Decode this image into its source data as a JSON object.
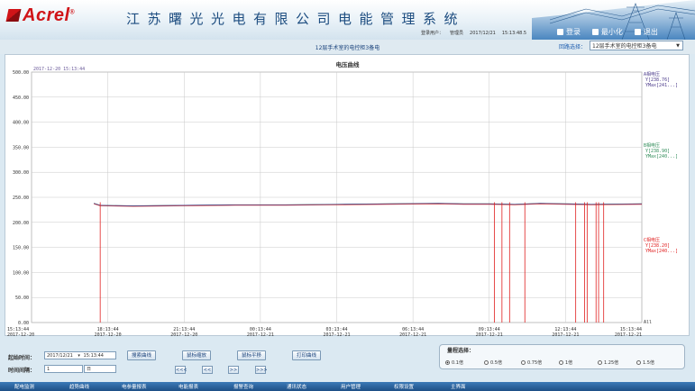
{
  "brand": {
    "logo_text": "Acrel",
    "company_name": "江苏曙光光电有限公司电能管理系统"
  },
  "login_info": {
    "user_label": "登录用户：",
    "user_name": "管理员",
    "date": "2017/12/21",
    "time": "15:13:48.5"
  },
  "top_buttons": [
    {
      "label": "登录",
      "icon": "login-icon"
    },
    {
      "label": "最小化",
      "icon": "minimize-icon"
    },
    {
      "label": "退出",
      "icon": "exit-icon"
    }
  ],
  "page": {
    "title": "12层手术室的电控柜3备电"
  },
  "loop": {
    "label": "回路选择：",
    "selected": "12层手术室的电控柜3备电"
  },
  "chart_data": {
    "type": "line",
    "title": "电压曲线",
    "timestamp_label": "2017-12-20 15:13:44",
    "y_ticks": [
      "500.00",
      "450.00",
      "400.00",
      "350.00",
      "300.00",
      "250.00",
      "200.00",
      "150.00",
      "100.00",
      "50.00",
      "0.00"
    ],
    "ylim": [
      0,
      500
    ],
    "x_ticks": [
      {
        "time": "15:13:44",
        "date": "2017-12-20"
      },
      {
        "time": "18:13:44",
        "date": "2017-12-20"
      },
      {
        "time": "21:13:44",
        "date": "2017-12-20"
      },
      {
        "time": "00:13:44",
        "date": "2017-12-21"
      },
      {
        "time": "03:13:44",
        "date": "2017-12-21"
      },
      {
        "time": "06:13:44",
        "date": "2017-12-21"
      },
      {
        "time": "09:13:44",
        "date": "2017-12-21"
      },
      {
        "time": "12:13:44",
        "date": "2017-12-21"
      },
      {
        "time": "15:13:44",
        "date": "2017-12-21"
      }
    ],
    "x_hours": [
      0,
      24
    ],
    "grid": true,
    "series": [
      {
        "name": "A相电压",
        "color": "#4a3a8a",
        "value_text": "Y[238.76]",
        "max_text": "YMax[241...]"
      },
      {
        "name": "B相电压",
        "color": "#2e8b57",
        "value_text": "Y[238.90]",
        "max_text": "YMax[240...]"
      },
      {
        "name": "C相电压",
        "color": "#e02020",
        "value_text": "Y[238.20]",
        "max_text": "YMax[240...]"
      }
    ],
    "legend_all": "All",
    "start_hour": 2.45,
    "series_values": {
      "baseline": [
        [
          2.45,
          238
        ],
        [
          2.7,
          234
        ],
        [
          4,
          233
        ],
        [
          6,
          234
        ],
        [
          8,
          235
        ],
        [
          10,
          235
        ],
        [
          12,
          236
        ],
        [
          14,
          237
        ],
        [
          16,
          238
        ],
        [
          17,
          237
        ],
        [
          18,
          237
        ],
        [
          19,
          236
        ],
        [
          20,
          238
        ],
        [
          21,
          237
        ],
        [
          22,
          236
        ],
        [
          24,
          237
        ]
      ],
      "c_drops": [
        2.7,
        18.2,
        18.5,
        18.8,
        19.4,
        21.4,
        21.75,
        21.85,
        22.2,
        22.3,
        22.5
      ]
    }
  },
  "controls": {
    "start_label": "起始时间：",
    "start_date": "2017/12/21",
    "start_time": "15:13:44",
    "interval_label": "时间间隔：",
    "interval_value": "1",
    "interval_unit": "日",
    "search_btn": "搜索曲线",
    "zoom_btn": "鼠标缩放",
    "pan_btn": "鼠标平移",
    "print_btn": "打印曲线",
    "nav_prev_fast": "<<<",
    "nav_prev": "<<",
    "nav_next": ">>",
    "nav_next_fast": ">>>"
  },
  "range": {
    "title": "量程选择：",
    "options": [
      "0.1倍",
      "0.5倍",
      "0.75倍",
      "1倍",
      "1.25倍",
      "1.5倍"
    ],
    "selected_index": 0
  },
  "bottom_nav": [
    "配电监测",
    "趋势曲线",
    "电参量报表",
    "电能报表",
    "报警查询",
    "通讯状态",
    "用户管理",
    "权限设置",
    "主界面"
  ]
}
